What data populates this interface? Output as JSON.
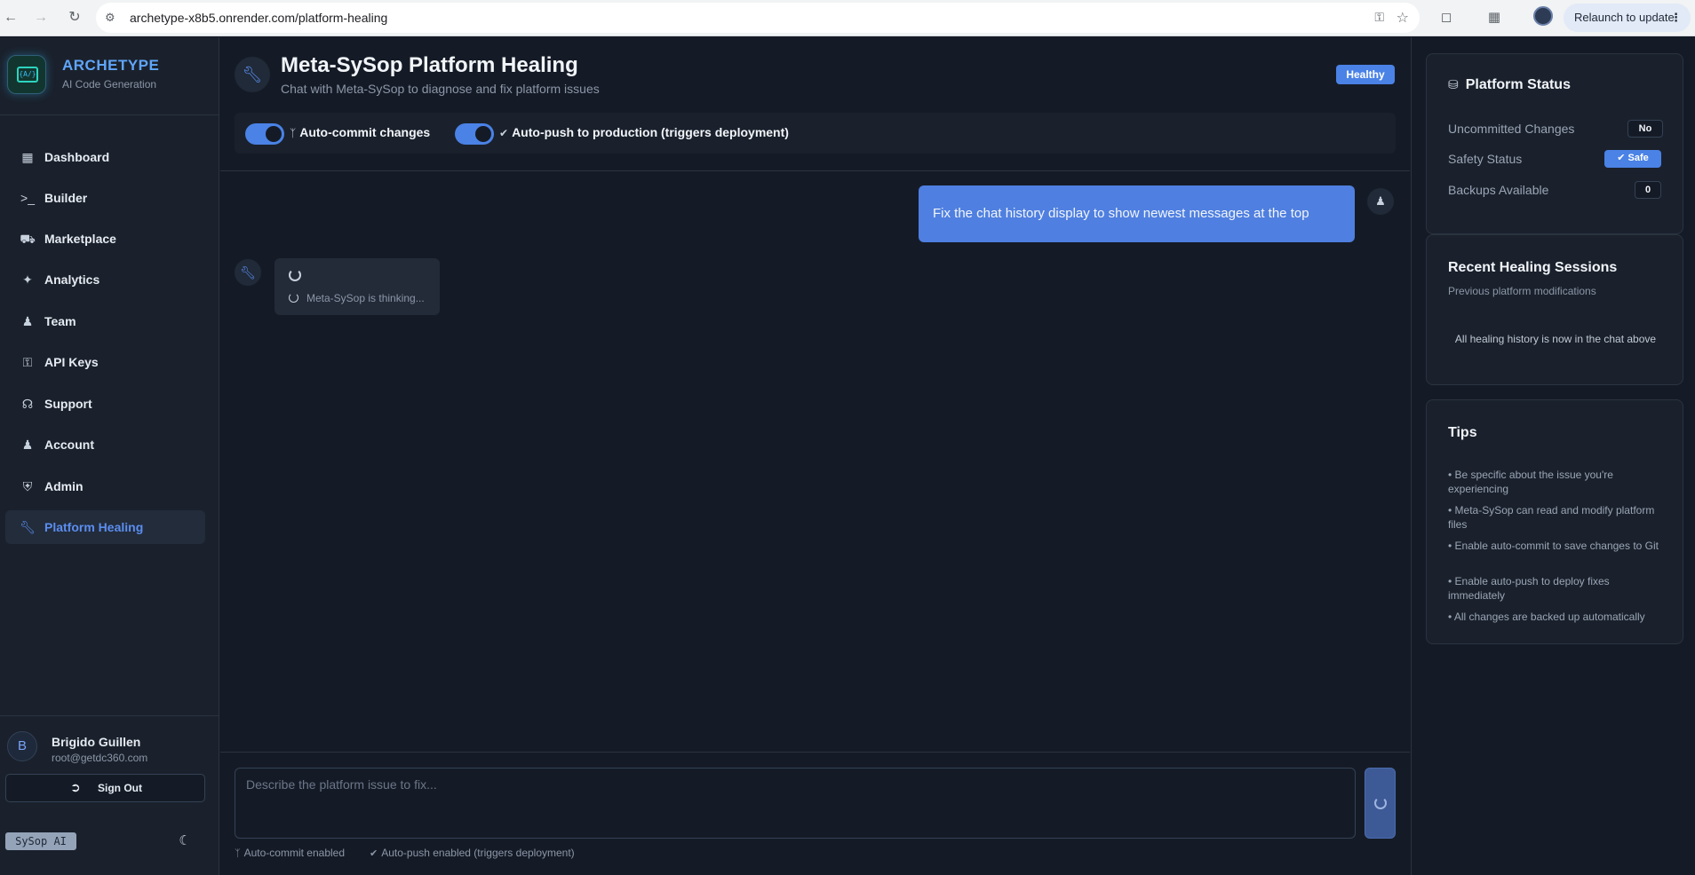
{
  "browser": {
    "url": "archetype-x8b5.onrender.com/platform-healing",
    "relaunch_label": "Relaunch to update"
  },
  "sidebar": {
    "brand": "ARCHETYPE",
    "brand_sub": "AI Code Generation",
    "logo_text": "{A/}",
    "items": [
      {
        "label": "Dashboard",
        "icon": "grid-icon"
      },
      {
        "label": "Builder",
        "icon": "terminal-icon"
      },
      {
        "label": "Marketplace",
        "icon": "cart-icon"
      },
      {
        "label": "Analytics",
        "icon": "sparkle-icon"
      },
      {
        "label": "Team",
        "icon": "users-icon"
      },
      {
        "label": "API Keys",
        "icon": "key-icon"
      },
      {
        "label": "Support",
        "icon": "headphones-icon"
      },
      {
        "label": "Account",
        "icon": "user-icon"
      },
      {
        "label": "Admin",
        "icon": "shield-icon"
      },
      {
        "label": "Platform Healing",
        "icon": "wrench-icon",
        "active": true
      }
    ],
    "user": {
      "initial": "B",
      "name": "Brigido Guillen",
      "email": "root@getdc360.com"
    },
    "signout_label": "Sign Out",
    "sysop_badge": "SySop AI"
  },
  "header": {
    "title": "Meta-SySop Platform Healing",
    "subtitle": "Chat with Meta-SySop to diagnose and fix platform issues",
    "status_badge": "Healthy"
  },
  "toggles": {
    "auto_commit": {
      "label": "Auto-commit changes",
      "on": true
    },
    "auto_push": {
      "label": "Auto-push to production (triggers deployment)",
      "on": true
    }
  },
  "chat": {
    "messages": [
      {
        "role": "user",
        "text": "Fix the chat history display to show newest messages at the top"
      }
    ],
    "thinking_text": "Meta-SySop is thinking...",
    "input_placeholder": "Describe the platform issue to fix...",
    "status_commit": "Auto-commit enabled",
    "status_push": "Auto-push enabled (triggers deployment)"
  },
  "platform_status": {
    "title": "Platform Status",
    "rows": [
      {
        "label": "Uncommitted Changes",
        "value": "No"
      },
      {
        "label": "Safety Status",
        "value": "Safe"
      },
      {
        "label": "Backups Available",
        "value": "0"
      }
    ]
  },
  "recent_sessions": {
    "title": "Recent Healing Sessions",
    "subtitle": "Previous platform modifications",
    "empty_text": "All healing history is now in the chat above"
  },
  "tips": {
    "title": "Tips",
    "items": [
      "• Be specific about the issue you're experiencing",
      "• Meta-SySop can read and modify platform files",
      "• Enable auto-commit to save changes to Git",
      "• Enable auto-push to deploy fixes immediately",
      "• All changes are backed up automatically"
    ]
  },
  "colors": {
    "accent": "#4a82e6",
    "background": "#151b26",
    "sidebar": "#1a212c"
  }
}
